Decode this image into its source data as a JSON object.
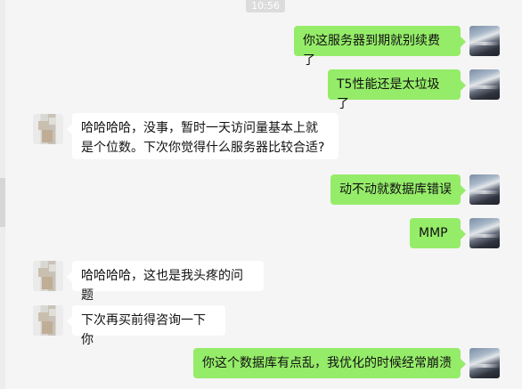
{
  "header": {
    "time": "10:56"
  },
  "messages": [
    {
      "side": "right",
      "text": "你这服务器到期就别续费了"
    },
    {
      "side": "right",
      "text": "T5性能还是太垃圾了"
    },
    {
      "side": "left",
      "text": "哈哈哈哈，没事，暂时一天访问量基本上就是个位数。下次你觉得什么服务器比较合适?"
    },
    {
      "side": "right",
      "text": "动不动就数据库错误"
    },
    {
      "side": "right",
      "text": "MMP"
    },
    {
      "side": "left",
      "text": "哈哈哈哈，这也是我头疼的问题"
    },
    {
      "side": "left",
      "text": "下次再买前得咨询一下你"
    },
    {
      "side": "right",
      "text": "你这个数据库有点乱，我优化的时候经常崩溃"
    }
  ]
}
